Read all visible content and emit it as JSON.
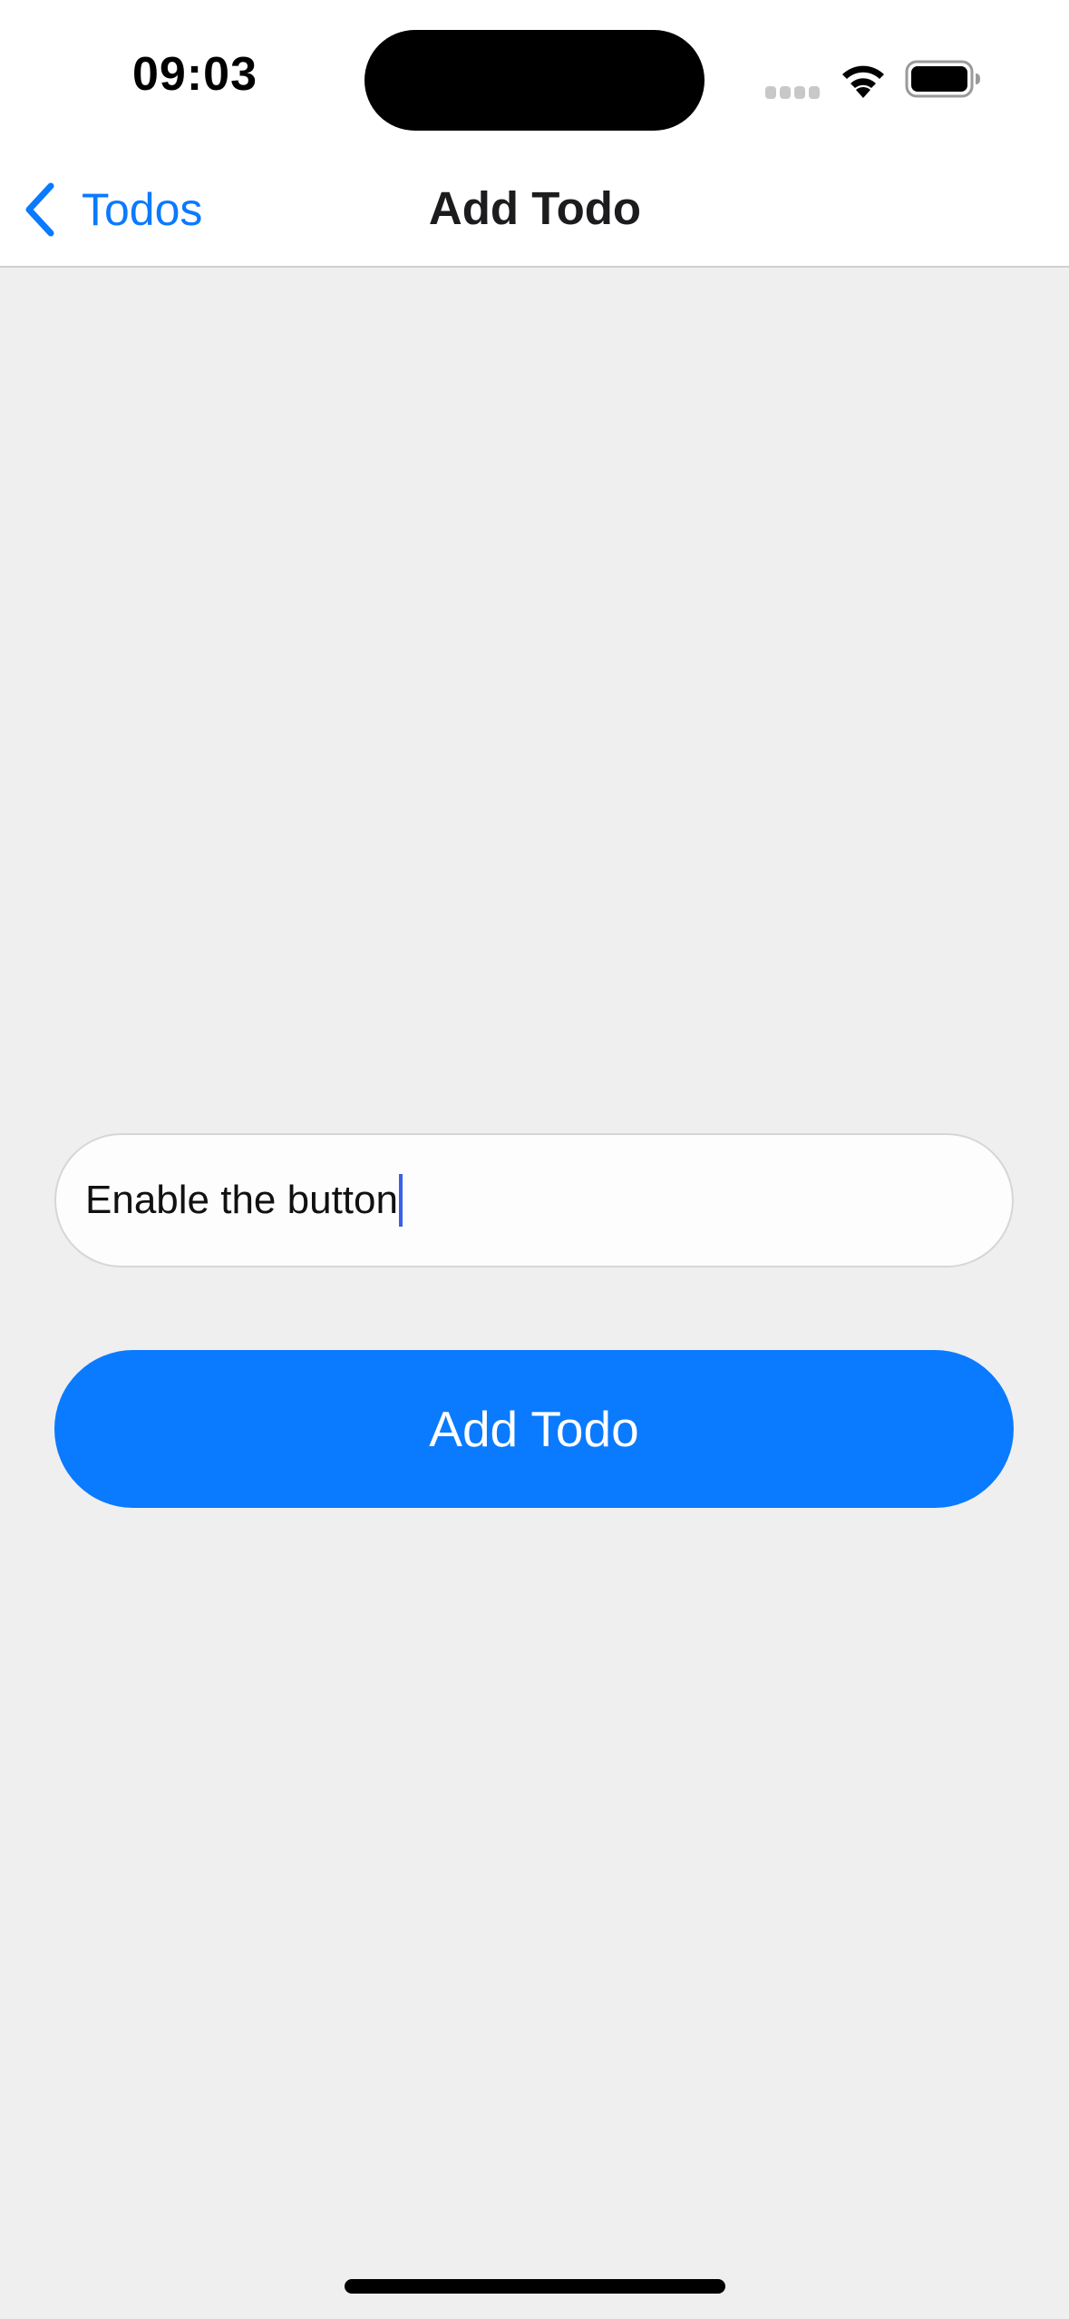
{
  "status_bar": {
    "time": "09:03",
    "icons": [
      "cellular-signal-icon",
      "wifi-icon",
      "battery-icon"
    ]
  },
  "nav_bar": {
    "back_label": "Todos",
    "back_icon": "chevron-left-icon",
    "title": "Add Todo"
  },
  "form": {
    "input_value": "Enable the button",
    "button_label": "Add Todo"
  },
  "colors": {
    "accent": "#0a7aff",
    "background": "#efefef",
    "surface": "#ffffff",
    "caret": "#3a5fe8"
  }
}
